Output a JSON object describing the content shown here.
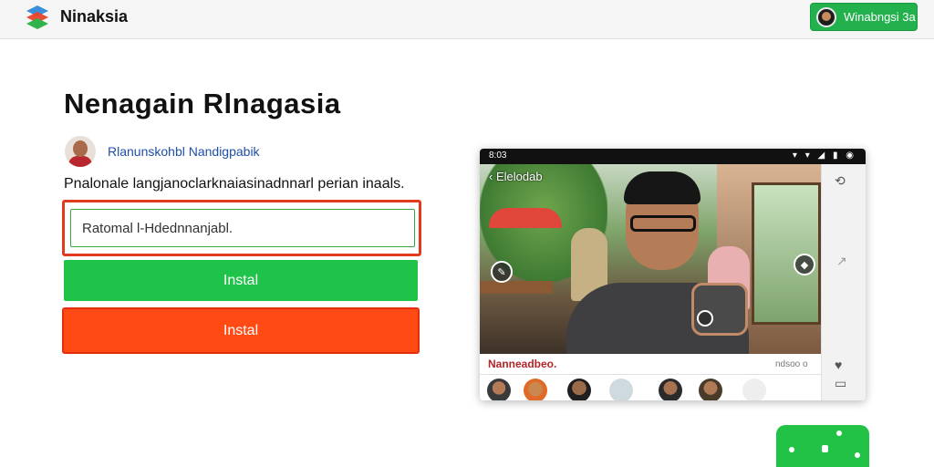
{
  "app": {
    "brand": "Ninaksia",
    "user_button_label": "Winabngsi 3a"
  },
  "main": {
    "title": "Nenagain Rlnagasia",
    "author_name": "Rlanunskohbl Nandigpabik",
    "description": "Pnalonale langjanoclarknaiasinadnnarl perian inaals.",
    "input": {
      "value": "Ratomal l-Hdednnanjabl.",
      "placeholder": ""
    },
    "primary_button_label": "Instal",
    "secondary_button_label": "Instal"
  },
  "phone_preview": {
    "status_time": "8:03",
    "status_icons": "▾ ▾ ◢ ▮ ◉",
    "back_label": "Elelodab",
    "caption": "Nanneadbeo.",
    "caption_meta": "ndsoo o",
    "side_icons": [
      "rotate-icon",
      "heart-icon",
      "comment-icon",
      "share-icon"
    ]
  },
  "colors": {
    "accent_green": "#20c34a",
    "accent_orange": "#ff4a14",
    "highlight_red": "#e23a1e",
    "link_blue": "#1f4fa8"
  }
}
